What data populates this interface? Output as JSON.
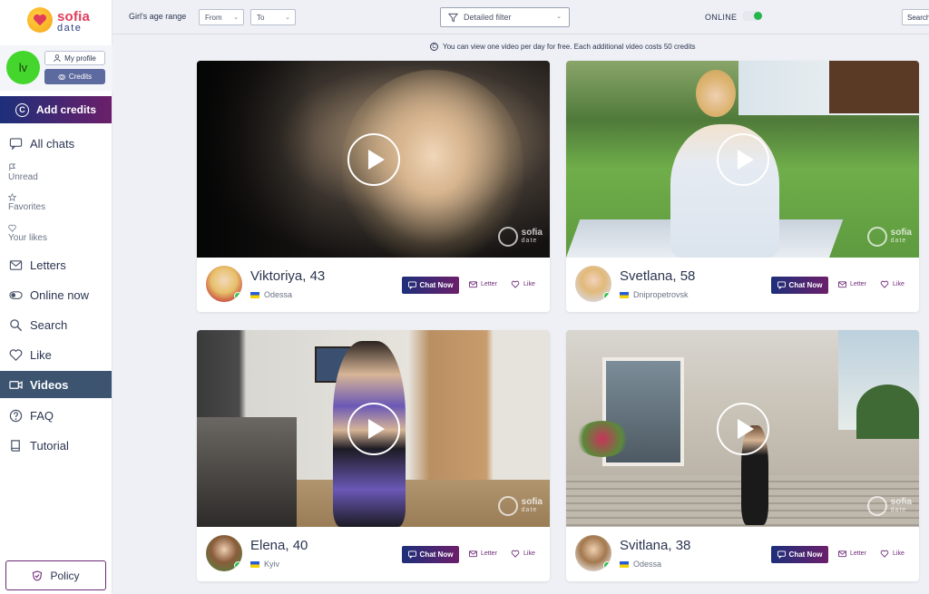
{
  "brand": {
    "name_top": "sofia",
    "name_bottom": "date"
  },
  "user": {
    "initials": "lv",
    "my_profile": "My profile",
    "credits": "Credits"
  },
  "add_credits": "Add credits",
  "nav": {
    "all_chats": "All chats",
    "unread": "Unread",
    "favorites": "Favorites",
    "your_likes": "Your likes",
    "letters": "Letters",
    "online_now": "Online now",
    "search": "Search",
    "like": "Like",
    "videos": "Videos",
    "faq": "FAQ",
    "tutorial": "Tutorial"
  },
  "policy": "Policy",
  "filters": {
    "age_label": "Girl's age range",
    "from": "From",
    "to": "To",
    "detailed": "Detailed filter",
    "online": "ONLINE",
    "online_on": true,
    "search": "Search"
  },
  "notice": "You can view one video per day for free. Each additional video costs 50 credits",
  "actions": {
    "chat_now": "Chat Now",
    "letter": "Letter",
    "like": "Like"
  },
  "watermark": {
    "top": "sofia",
    "bottom": "date"
  },
  "cards": [
    {
      "name": "Viktoriya, 43",
      "city": "Odessa"
    },
    {
      "name": "Svetlana, 58",
      "city": "Dnipropetrovsk"
    },
    {
      "name": "Elena, 40",
      "city": "Kyiv"
    },
    {
      "name": "Svitlana, 38",
      "city": "Odessa"
    }
  ],
  "colors": {
    "accent_gradient_start": "#1d2f7a",
    "accent_gradient_end": "#6c1f6a",
    "online_green": "#2fc24f",
    "active_nav": "#3c5470"
  }
}
